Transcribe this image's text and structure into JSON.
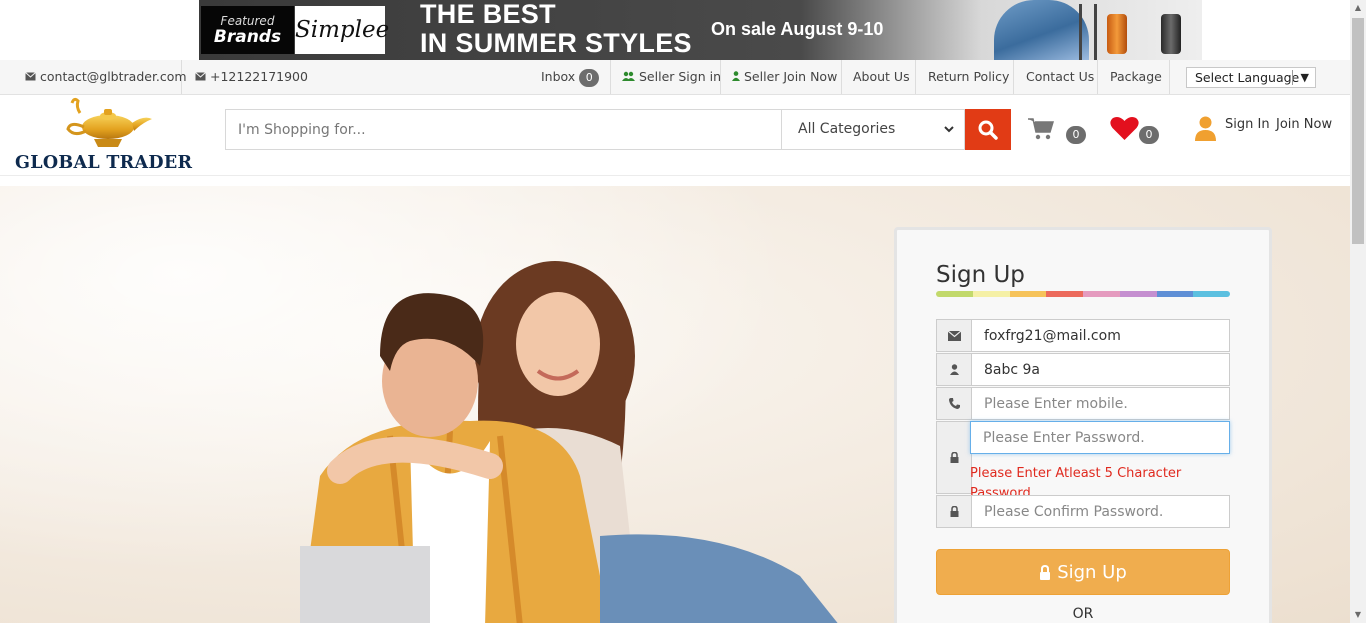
{
  "banner": {
    "featured_line1": "Featured",
    "featured_line2": "Brands",
    "brand_name": "Simplee",
    "headline_line1": "THE BEST",
    "headline_line2": "IN SUMMER STYLES",
    "sale_text": "On sale August 9-10"
  },
  "util_bar": {
    "email": "contact@glbtrader.com",
    "phone": "+12122171900",
    "inbox_label": "Inbox",
    "inbox_count": "0",
    "seller_sign_in": "Seller Sign in",
    "seller_join_now": "Seller Join Now",
    "about_us": "About Us",
    "return_policy": "Return Policy",
    "contact_us": "Contact Us",
    "package": "Package",
    "language_select": "Select Language"
  },
  "header": {
    "logo_text": "GLOBAL TRADER",
    "search_placeholder": "I'm Shopping for...",
    "category_select": "All Categories",
    "cart_count": "0",
    "wishlist_count": "0",
    "sign_in": "Sign In",
    "join_now": "Join Now"
  },
  "signup": {
    "title": "Sign Up",
    "rainbow_colors": [
      "#c2d96b",
      "#f5f0a6",
      "#f6c35a",
      "#ec6a5c",
      "#e59bbf",
      "#c58fd0",
      "#5f8fd6",
      "#5cc0e0"
    ],
    "email_value": "foxfrg21@mail.com",
    "username_value": "8abc 9a",
    "mobile_placeholder": "Please Enter mobile.",
    "password_placeholder": "Please Enter Password.",
    "password_error": "Please Enter Atleast 5 Character Password.",
    "confirm_placeholder": "Please Confirm Password.",
    "button_label": "Sign Up",
    "or_text": "OR"
  },
  "colors": {
    "accent_orange": "#f0ad4e",
    "search_red": "#e13b15",
    "error_red": "#e02a1f",
    "logo_navy": "#0e2a4e",
    "user_icon_orange": "#f0a030",
    "heart_red": "#e3101e"
  }
}
